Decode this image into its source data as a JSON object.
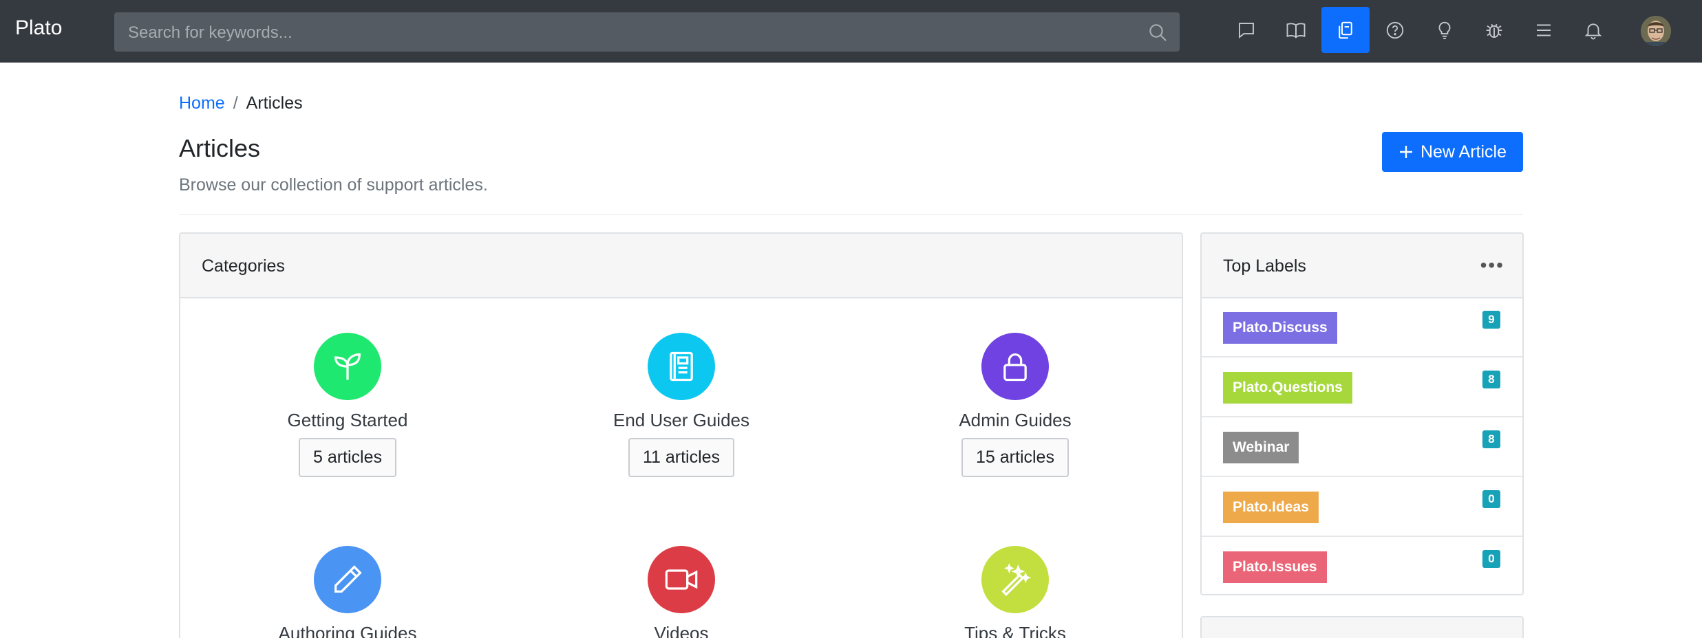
{
  "navbar": {
    "brand": "Plato",
    "search_placeholder": "Search for keywords...",
    "icons": [
      "chat-icon",
      "book-open-icon",
      "documents-icon",
      "question-icon",
      "lightbulb-icon",
      "bug-icon",
      "menu-icon",
      "bell-icon"
    ],
    "active_icon": "documents-icon"
  },
  "breadcrumb": {
    "home": "Home",
    "separator": "/",
    "current": "Articles"
  },
  "header": {
    "title": "Articles",
    "subtitle": "Browse our collection of support articles.",
    "new_button": "New Article",
    "new_button_icon": "plus-icon"
  },
  "categories": {
    "title": "Categories",
    "items": [
      {
        "name": "Getting Started",
        "count": "5 articles",
        "color": "#1ee86f",
        "icon": "sprout-icon"
      },
      {
        "name": "End User Guides",
        "count": "11 articles",
        "color": "#0cc7ef",
        "icon": "book-icon"
      },
      {
        "name": "Admin Guides",
        "count": "15 articles",
        "color": "#6f42e1",
        "icon": "lock-icon"
      },
      {
        "name": "Authoring Guides",
        "count": "",
        "color": "#4a94f4",
        "icon": "pencil-icon"
      },
      {
        "name": "Videos",
        "count": "",
        "color": "#dc3c45",
        "icon": "video-icon"
      },
      {
        "name": "Tips & Tricks",
        "count": "",
        "color": "#c3df3f",
        "icon": "magic-wand-icon"
      }
    ]
  },
  "top_labels": {
    "title": "Top Labels",
    "menu_icon": "more-dots-icon",
    "items": [
      {
        "label": "Plato.Discuss",
        "count": "9",
        "color": "#7b6fe3"
      },
      {
        "label": "Plato.Questions",
        "count": "8",
        "color": "#a6d83b"
      },
      {
        "label": "Webinar",
        "count": "8",
        "color": "#8c8c8c"
      },
      {
        "label": "Plato.Ideas",
        "count": "0",
        "color": "#eda94a"
      },
      {
        "label": "Plato.Issues",
        "count": "0",
        "color": "#ea6577"
      }
    ]
  }
}
